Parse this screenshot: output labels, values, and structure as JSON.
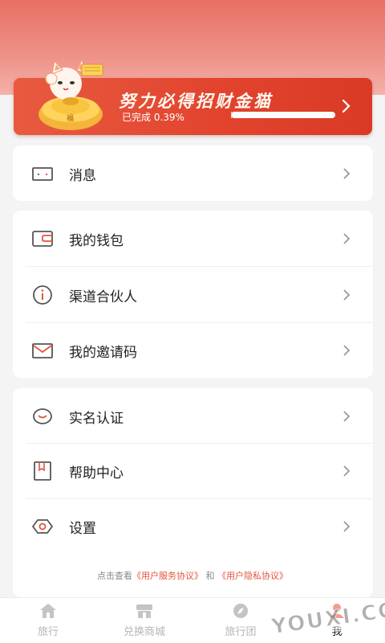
{
  "banner": {
    "title": "努力必得招财金猫",
    "progress_text": "已完成 0.39%",
    "progress": 0.0039
  },
  "menu_groups": [
    {
      "items": [
        {
          "label": "消息",
          "icon": "message-icon"
        }
      ]
    },
    {
      "items": [
        {
          "label": "我的钱包",
          "icon": "wallet-icon"
        },
        {
          "label": "渠道合伙人",
          "icon": "info-icon"
        },
        {
          "label": "我的邀请码",
          "icon": "mail-icon"
        }
      ]
    },
    {
      "items": [
        {
          "label": "实名认证",
          "icon": "smile-icon"
        },
        {
          "label": "帮助中心",
          "icon": "help-book-icon"
        },
        {
          "label": "设置",
          "icon": "settings-icon"
        }
      ]
    }
  ],
  "footer": {
    "prefix": "点击查看",
    "service_link": "《用户服务协议》",
    "and": "和",
    "privacy_link": "《用户隐私协议》"
  },
  "bottom_nav": [
    {
      "label": "旅行",
      "icon": "home-icon"
    },
    {
      "label": "兑换商城",
      "icon": "store-icon"
    },
    {
      "label": "旅行团",
      "icon": "compass-icon"
    },
    {
      "label": "我",
      "icon": "profile-icon",
      "active": true
    }
  ],
  "watermark": "YOUXI.com",
  "colors": {
    "accent": "#e2553d",
    "header": "#e86f63",
    "icon": "#9a9a9a"
  }
}
